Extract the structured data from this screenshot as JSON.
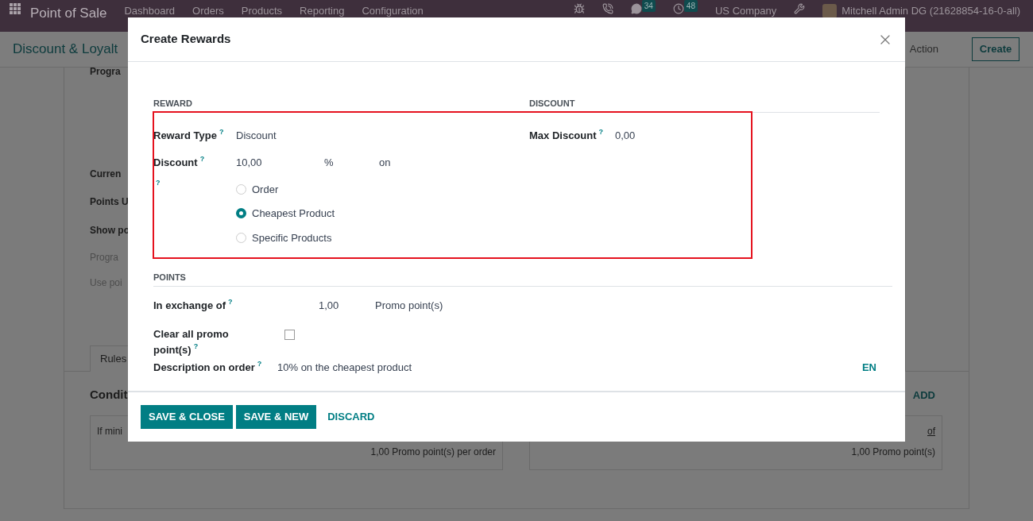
{
  "navbar": {
    "app_name": "Point of Sale",
    "menu": [
      "Dashboard",
      "Orders",
      "Products",
      "Reporting",
      "Configuration"
    ],
    "chat_count": "34",
    "activity_count": "48",
    "company": "US Company",
    "user": "Mitchell Admin DG (21628854-16-0-all)"
  },
  "control_panel": {
    "breadcrumb": "Discount & Loyalt",
    "action": "Action",
    "create": "Create"
  },
  "form_background": {
    "labels": [
      {
        "text": "Progra",
        "muted": false
      },
      {
        "text": "Curren",
        "muted": false
      },
      {
        "text": "Points U",
        "muted": false
      },
      {
        "text": "Show po",
        "muted": false
      },
      {
        "text": "Progra",
        "muted": true
      },
      {
        "text": "Use poi",
        "muted": true
      }
    ],
    "tab": "Rules",
    "section": "Condit",
    "add": "ADD",
    "cards": [
      {
        "text": "If mini",
        "footer": "1,00 Promo point(s) per order"
      },
      {
        "text": "of",
        "footer": "1,00 Promo point(s)"
      }
    ]
  },
  "dialog": {
    "title": "Create Rewards",
    "reward": {
      "heading": "REWARD",
      "reward_type": {
        "label": "Reward Type",
        "help": "?",
        "value": "Discount"
      },
      "discount": {
        "label": "Discount",
        "help": "?",
        "value": "10,00",
        "unit": "%",
        "suffix": "on"
      },
      "apply_on_help": "?",
      "apply_on": [
        {
          "label": "Order",
          "selected": false
        },
        {
          "label": "Cheapest Product",
          "selected": true
        },
        {
          "label": "Specific Products",
          "selected": false
        }
      ]
    },
    "discount_section": {
      "heading": "DISCOUNT",
      "max_discount": {
        "label": "Max Discount",
        "help": "?",
        "value": "0,00"
      }
    },
    "points": {
      "heading": "POINTS",
      "exchange": {
        "label": "In exchange of",
        "help": "?",
        "value": "1,00",
        "unit": "Promo point(s)"
      },
      "clear_all": {
        "label": "Clear all promo point(s)",
        "help": "?",
        "checked": false
      },
      "description": {
        "label": "Description on order",
        "help": "?",
        "value": "10% on the cheapest product",
        "lang": "EN"
      }
    },
    "buttons": [
      {
        "label": "SAVE & CLOSE",
        "kind": "primary"
      },
      {
        "label": "SAVE & NEW",
        "kind": "primary"
      },
      {
        "label": "DISCARD",
        "kind": "link"
      }
    ]
  }
}
